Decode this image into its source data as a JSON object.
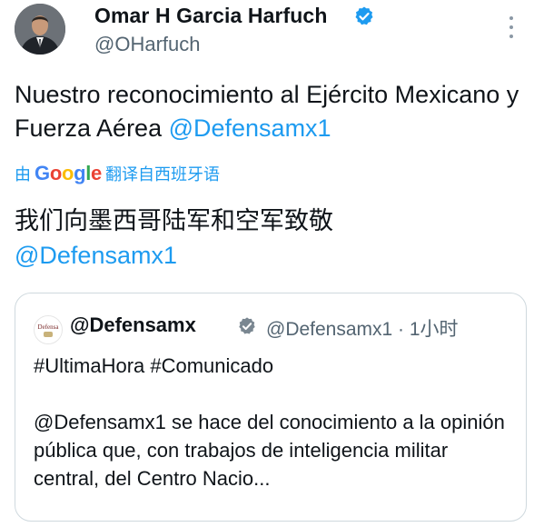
{
  "author": {
    "name": "Omar H Garcia Harfuch",
    "handle": "@OHarfuch",
    "verified": true
  },
  "tweet": {
    "text_before": "Nuestro reconocimiento al Ejército Mexicano y Fuerza Aérea ",
    "mention": "@Defensamx1"
  },
  "translation": {
    "prefix": "由",
    "provider_letters": [
      "G",
      "o",
      "o",
      "g",
      "l",
      "e"
    ],
    "suffix": "翻译自西班牙语",
    "text": "我们向墨西哥陆军和空军致敬",
    "mention": "@Defensamx1"
  },
  "quoted": {
    "name": "@Defensamx",
    "handle_time": "@Defensamx1 · 1小时",
    "avatar_text": "Defensa",
    "hashtags": "#UltimaHora #Comunicado",
    "body": "@Defensamx1  se hace del conocimiento a la opinión pública que, con trabajos de inteligencia militar central, del Centro Nacio..."
  },
  "colors": {
    "link": "#1d9bf0",
    "verified": "#1d9bf0",
    "text": "#0f1419",
    "secondary": "#536471",
    "border": "#cfd9de"
  },
  "icons": {
    "verified": "verified-badge-icon",
    "more": "more-options-icon"
  }
}
